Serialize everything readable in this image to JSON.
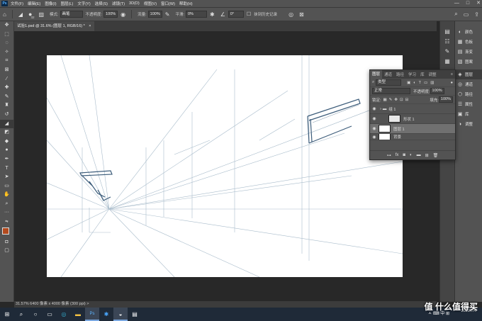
{
  "menubar": {
    "logo": "Ps",
    "items": [
      "文件(F)",
      "编辑(E)",
      "图像(I)",
      "图层(L)",
      "文字(Y)",
      "选择(S)",
      "滤镜(T)",
      "3D(D)",
      "视图(V)",
      "窗口(W)",
      "帮助(H)"
    ],
    "minimize": "—",
    "maximize": "□",
    "close": "✕"
  },
  "options": {
    "brush_size": "32",
    "mode_label": "模式:",
    "mode_value": "画笔",
    "opacity_label": "不透明度:",
    "opacity_value": "100%",
    "flow_label": "流量:",
    "flow_value": "100%",
    "smooth_label": "平滑:",
    "smooth_value": "0%",
    "angle_value": "0°",
    "history_label": "抹到历史记录"
  },
  "document": {
    "tab_title": "试验1.psd @ 31.6% (图层 1, RGB/16) *",
    "close": "×"
  },
  "status": {
    "text": "31.57%   6400 像素 x 4000 像素 (300 ppi)   >"
  },
  "right_panels": [
    {
      "icon": "palette-icon",
      "glyph": "◐",
      "label": "颜色"
    },
    {
      "icon": "swatches-icon",
      "glyph": "▦",
      "label": "色板"
    },
    {
      "icon": "gradient-icon",
      "glyph": "▤",
      "label": "渐变"
    },
    {
      "icon": "pattern-icon",
      "glyph": "▧",
      "label": "图案"
    },
    {
      "icon": "layers-icon",
      "glyph": "◈",
      "label": "图层"
    },
    {
      "icon": "channels-icon",
      "glyph": "◎",
      "label": "通道"
    },
    {
      "icon": "paths-icon",
      "glyph": "⬡",
      "label": "路径"
    },
    {
      "icon": "properties-icon",
      "glyph": "☰",
      "label": "属性"
    },
    {
      "icon": "libraries-icon",
      "glyph": "▣",
      "label": "库"
    },
    {
      "icon": "adjustments-icon",
      "glyph": "◑",
      "label": "调整"
    }
  ],
  "layers_panel": {
    "tabs": [
      "图层",
      "通道",
      "路径",
      "学习",
      "库",
      "调整"
    ],
    "filter_value": "类型",
    "blend_mode": "正常",
    "opacity_label": "不透明度:",
    "opacity_value": "100%",
    "lock_label": "锁定:",
    "fill_label": "填充:",
    "fill_value": "100%",
    "layers": [
      {
        "name": "组 1",
        "type": "group"
      },
      {
        "name": "形状 1",
        "type": "shape"
      },
      {
        "name": "图层 1",
        "type": "layer",
        "selected": true
      },
      {
        "name": "背景",
        "type": "background"
      }
    ]
  },
  "taskbar": {
    "tray_text": "ㅅ  ⌨  中  ⊞",
    "time": "",
    "date": "2020/7/4"
  },
  "watermark": "值 什么值得买"
}
